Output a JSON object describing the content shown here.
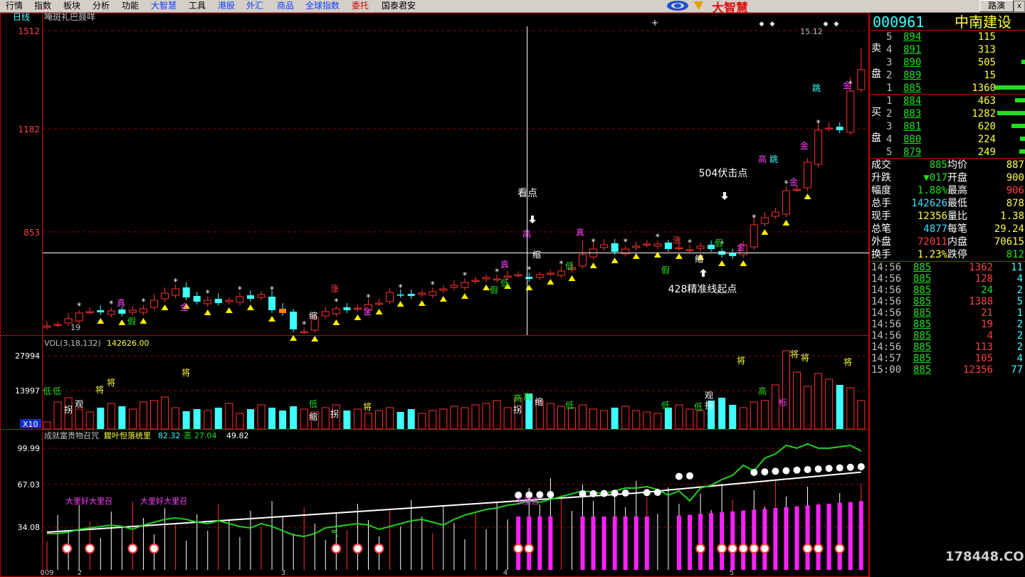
{
  "menubar": {
    "items": [
      {
        "label": "行情",
        "style": ""
      },
      {
        "label": "指数",
        "style": ""
      },
      {
        "label": "板块",
        "style": ""
      },
      {
        "label": "分析",
        "style": ""
      },
      {
        "label": "功能",
        "style": ""
      },
      {
        "label": "大智慧",
        "style": "hl"
      },
      {
        "label": "工具",
        "style": ""
      },
      {
        "label": "港股",
        "style": "hl"
      },
      {
        "label": "外汇",
        "style": "hl"
      },
      {
        "label": "商品",
        "style": "hl"
      },
      {
        "label": "全球指数",
        "style": "hl"
      },
      {
        "label": "委托",
        "style": "red"
      },
      {
        "label": "国泰君安",
        "style": ""
      }
    ],
    "logo_text": "大智慧",
    "corner_button": "路演",
    "corner_ctrl": "x"
  },
  "chart_header": {
    "period": "日线",
    "title": "唵斑礼巴聂咩"
  },
  "price_axis": {
    "labels": [
      "1512",
      "1182",
      "853"
    ]
  },
  "vol_axis": {
    "labels": [
      "27994",
      "13997"
    ],
    "multiplier": "X10"
  },
  "ind_axis": {
    "labels": [
      "99.99",
      "67.03",
      "34.08"
    ]
  },
  "vol_header": {
    "name": "VOL(3,18,132)",
    "value": "142626.00"
  },
  "ind_header": {
    "name": "成就富贵物召咒",
    "name2": "鍐叶怛落统里",
    "v1": "82.32",
    "v2_label": "恶",
    "v2": "27.04",
    "v3": "49.82"
  },
  "annotations": {
    "look_point": "看点",
    "point_504": "504伏击点",
    "point_428": "428精准线起点",
    "high_price": "15.12",
    "low_price": "19",
    "date_start": "009",
    "month_ticks": [
      "2",
      "3",
      "4",
      "5"
    ]
  },
  "stock": {
    "code": "000961",
    "name": "中南建设"
  },
  "order_book": {
    "sell_label_1": "卖",
    "sell_label_2": "盘",
    "buy_label_1": "买",
    "buy_label_2": "盘",
    "sells": [
      {
        "lvl": "5",
        "price": "894",
        "vol": "115",
        "bar": 0.0
      },
      {
        "lvl": "4",
        "price": "891",
        "vol": "313",
        "bar": 0.0
      },
      {
        "lvl": "3",
        "price": "890",
        "vol": "505",
        "bar": 0.12
      },
      {
        "lvl": "2",
        "price": "889",
        "vol": "15",
        "bar": 0.0
      },
      {
        "lvl": "1",
        "price": "885",
        "vol": "1360",
        "bar": 1.0
      }
    ],
    "buys": [
      {
        "lvl": "1",
        "price": "884",
        "vol": "463",
        "bar": 0.34
      },
      {
        "lvl": "2",
        "price": "883",
        "vol": "1282",
        "bar": 0.94
      },
      {
        "lvl": "3",
        "price": "881",
        "vol": "620",
        "bar": 0.46
      },
      {
        "lvl": "4",
        "price": "880",
        "vol": "224",
        "bar": 0.16
      },
      {
        "lvl": "5",
        "price": "879",
        "vol": "249",
        "bar": 0.18
      }
    ]
  },
  "quote": [
    {
      "l1": "成交",
      "v1": "885",
      "c1": "#20e020",
      "l2": "均价",
      "v2": "887",
      "c2": "#ffff40"
    },
    {
      "l1": "升跌",
      "v1": "▼017",
      "c1": "#20e020",
      "l2": "开盘",
      "v2": "900",
      "c2": "#ffff40"
    },
    {
      "l1": "幅度",
      "v1": "1.88%",
      "c1": "#20e020",
      "l2": "最高",
      "v2": "906",
      "c2": "#ff4040"
    },
    {
      "l1": "总手",
      "v1": "142626",
      "c1": "#40e0ff",
      "l2": "最低",
      "v2": "878",
      "c2": "#ffff40"
    },
    {
      "l1": "现手",
      "v1": "12356",
      "c1": "#ffff40",
      "l2": "量比",
      "v2": "1.38",
      "c2": "#ffff40"
    },
    {
      "l1": "总笔",
      "v1": "4877",
      "c1": "#40e0ff",
      "l2": "每笔",
      "v2": "29.24",
      "c2": "#ffff40"
    },
    {
      "l1": "外盘",
      "v1": "72011",
      "c1": "#ff4040",
      "l2": "内盘",
      "v2": "70615",
      "c2": "#ffff40"
    },
    {
      "l1": "换手",
      "v1": "1.23%",
      "c1": "#ffff40",
      "l2": "跌停",
      "v2": "812",
      "c2": "#20e020"
    }
  ],
  "ticks": [
    {
      "t": "14:56",
      "p": "885",
      "v": "1362",
      "n": "11",
      "vc": "#ff4040"
    },
    {
      "t": "14:56",
      "p": "885",
      "v": "128",
      "n": "4",
      "vc": "#ff4040"
    },
    {
      "t": "14:56",
      "p": "885",
      "v": "24",
      "n": "2",
      "vc": "#20e020"
    },
    {
      "t": "14:56",
      "p": "885",
      "v": "1388",
      "n": "5",
      "vc": "#ff4040"
    },
    {
      "t": "14:56",
      "p": "885",
      "v": "21",
      "n": "1",
      "vc": "#ff4040"
    },
    {
      "t": "14:56",
      "p": "885",
      "v": "19",
      "n": "2",
      "vc": "#ff4040"
    },
    {
      "t": "14:56",
      "p": "885",
      "v": "4",
      "n": "2",
      "vc": "#ff4040"
    },
    {
      "t": "14:56",
      "p": "885",
      "v": "113",
      "n": "2",
      "vc": "#ff4040"
    },
    {
      "t": "14:57",
      "p": "885",
      "v": "105",
      "n": "4",
      "vc": "#ff4040"
    },
    {
      "t": "15:00",
      "p": "885",
      "v": "12356",
      "n": "77",
      "vc": "#ff4040"
    }
  ],
  "watermark": "178448.COM",
  "colors": {
    "up": "#ff3030",
    "down": "#40ffff",
    "grid": "#8b0000",
    "axis": "#c00000"
  }
}
